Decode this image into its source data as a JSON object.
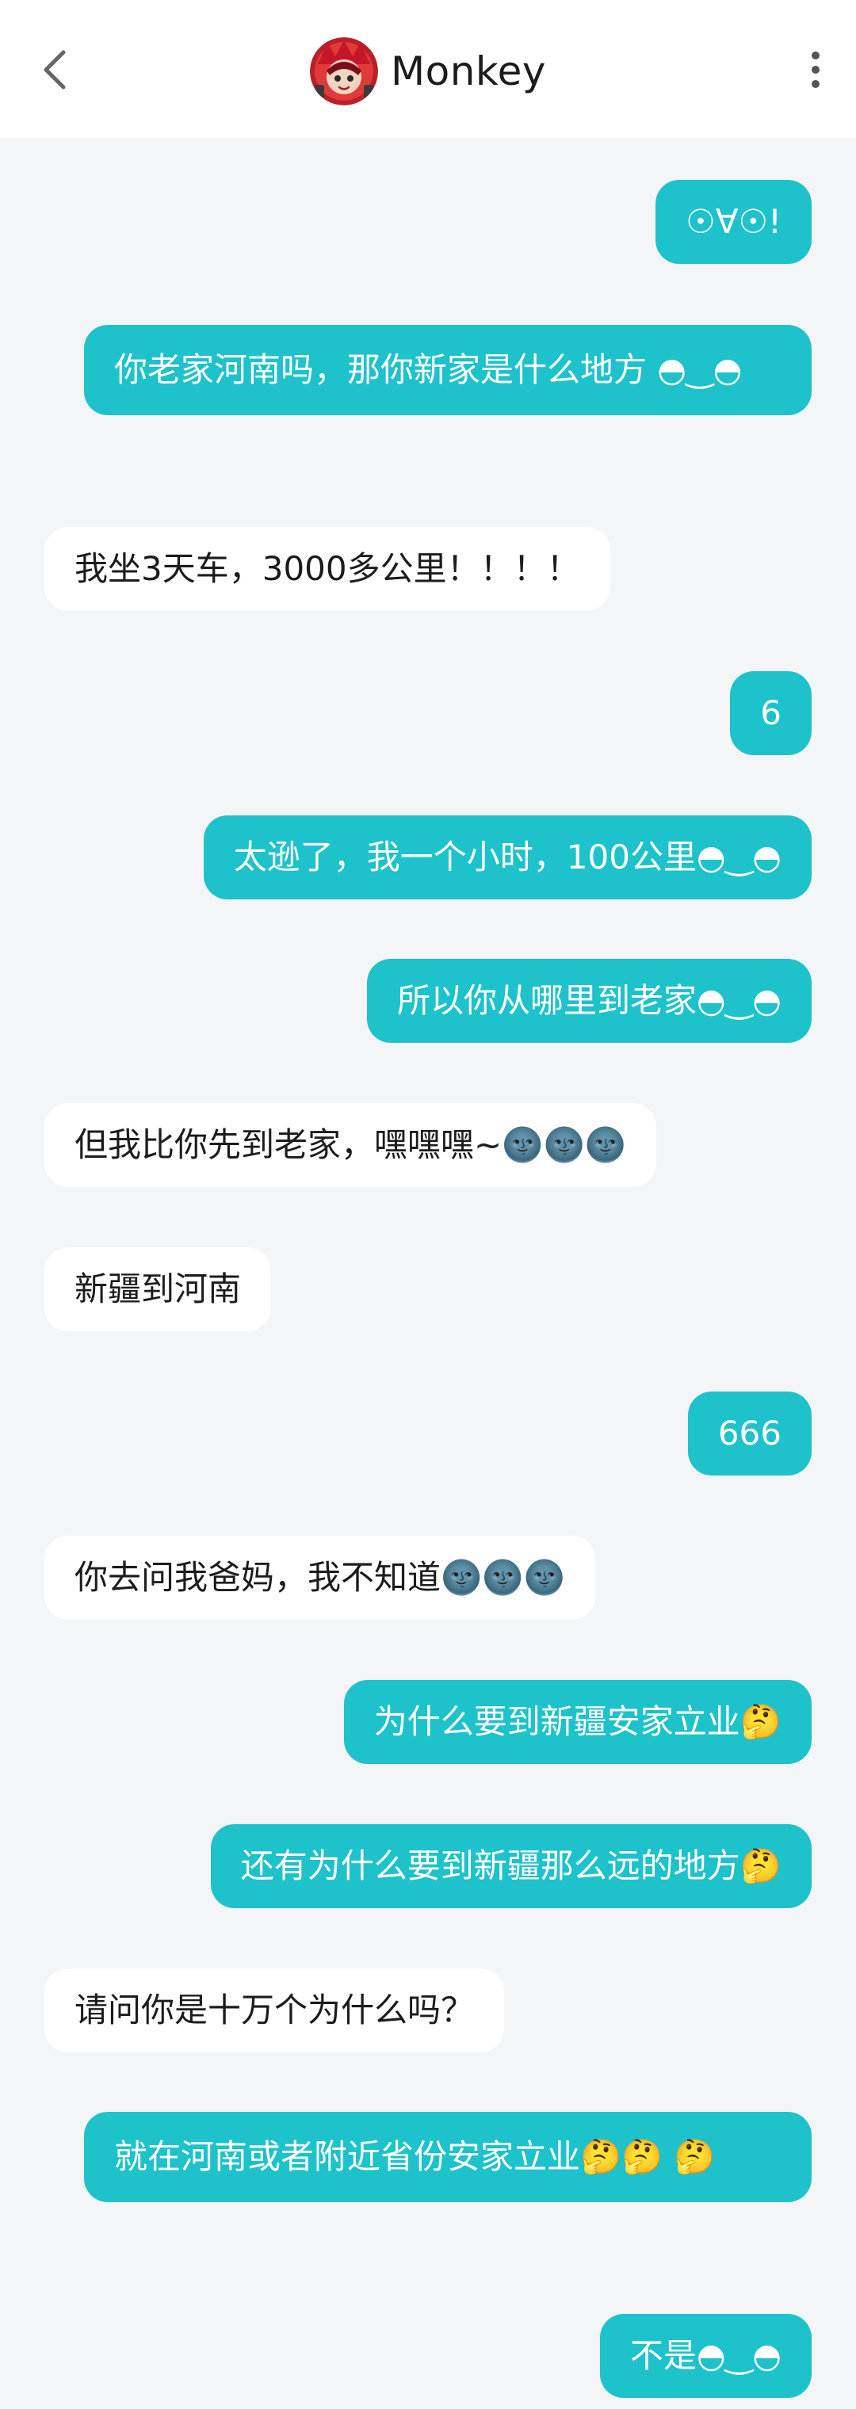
{
  "header": {
    "title": "Monkey",
    "back_icon": "chevron-left-icon",
    "more_icon": "vertical-dots-icon",
    "avatar": "monkey-avatar"
  },
  "colors": {
    "outgoing_bubble": "#1ec2ca",
    "incoming_bubble": "#ffffff",
    "background": "#f4f5f7"
  },
  "messages": [
    {
      "sender": "me",
      "text": "☉∀☉!"
    },
    {
      "sender": "me",
      "text": "你老家河南吗，那你新家是什么地方 ◓‿◓"
    },
    {
      "sender": "them",
      "text": "我坐3天车，3000多公里！！！！"
    },
    {
      "sender": "me",
      "text": "6"
    },
    {
      "sender": "me",
      "text": "太逊了，我一个小时，100公里◓‿◓"
    },
    {
      "sender": "me",
      "text": "所以你从哪里到老家◓‿◓"
    },
    {
      "sender": "them",
      "text": "但我比你先到老家，嘿嘿嘿~🌚🌚🌚"
    },
    {
      "sender": "them",
      "text": "新疆到河南"
    },
    {
      "sender": "me",
      "text": "666"
    },
    {
      "sender": "them",
      "text": "你去问我爸妈，我不知道🌚🌚🌚"
    },
    {
      "sender": "me",
      "text": "为什么要到新疆安家立业🤔"
    },
    {
      "sender": "me",
      "text": "还有为什么要到新疆那么远的地方🤔"
    },
    {
      "sender": "them",
      "text": "请问你是十万个为什么吗？"
    },
    {
      "sender": "me",
      "text": "就在河南或者附近省份安家立业🤔🤔 🤔"
    },
    {
      "sender": "me",
      "text": "不是◓‿◓"
    }
  ]
}
